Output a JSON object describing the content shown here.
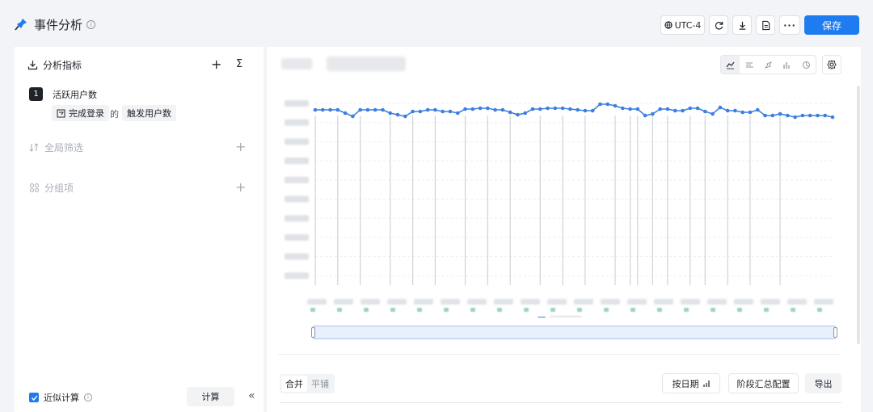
{
  "header": {
    "title": "事件分析",
    "timezone": "UTC-4",
    "more_label": "···",
    "save_label": "保存",
    "accent_color": "#1f7cf0"
  },
  "left": {
    "metrics_title": "分析指标",
    "metric_index": "1",
    "metric_name": "活跃用户数",
    "event_chip": "完成登录",
    "connector": "的",
    "measure_chip": "触发用户数",
    "filter_title": "全局筛选",
    "group_title": "分组项",
    "approx_label": "近似计算",
    "calc_label": "计算",
    "collapse_icon": "«"
  },
  "right": {
    "view_merge": "合并",
    "view_tile": "平铺",
    "by_date_label": "按日期",
    "stage_label": "阶段汇总配置",
    "export_label": "导出"
  },
  "chart_data": {
    "type": "line",
    "series": [
      {
        "values": [
          148,
          148,
          148,
          148,
          152,
          156,
          148,
          148,
          148,
          148,
          152,
          154,
          156,
          150,
          150,
          148,
          148,
          150,
          150,
          152,
          147,
          147,
          146,
          146,
          148,
          148,
          151,
          154,
          152,
          147,
          147,
          146,
          146,
          146,
          147,
          148,
          149,
          149,
          141,
          141,
          143,
          146,
          147,
          147,
          155,
          153,
          147,
          147,
          149,
          149,
          146,
          146,
          150,
          153,
          145,
          149,
          149,
          151,
          151,
          148,
          155,
          155,
          153,
          155,
          157,
          155,
          155,
          155,
          155,
          157
        ]
      }
    ],
    "color": "#3d7fe0",
    "event_markers": true
  }
}
